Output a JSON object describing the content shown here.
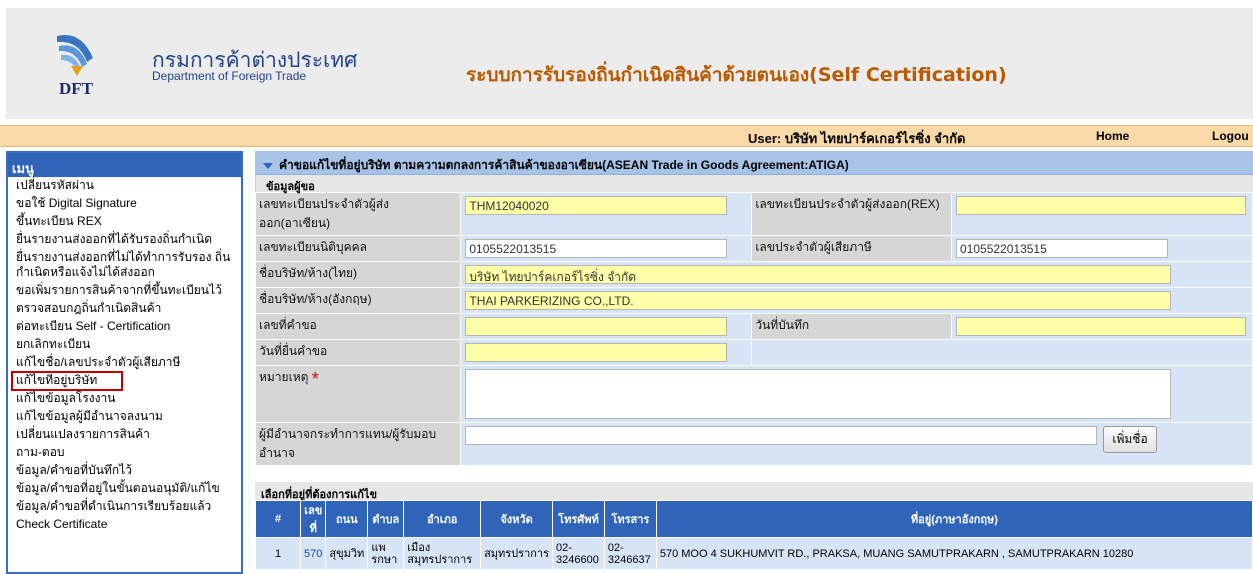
{
  "header": {
    "dept_th": "กรมการค้าต่างประเทศ",
    "dept_en": "Department of Foreign Trade",
    "logo_text": "DFT",
    "system_title": "ระบบการรับรองถิ่นกำเนิดสินค้าด้วยตนเอง(Self Certification)"
  },
  "userbar": {
    "user_label": "User: บริษัท ไทยปาร์คเกอร์ไรซิ่ง จำกัด",
    "home": "Home",
    "logout": "Logou"
  },
  "sidebar": {
    "title": "เมนู",
    "items": [
      "เปลี่ยนรหัสผ่าน",
      "ขอใช้ Digital Signature",
      "ขึ้นทะเบียน REX",
      "ยื่นรายงานส่งออกที่ได้รับรองถิ่นกำเนิด",
      "ยื่นรายงานส่งออกที่ไม่ได้ทำการรับรอง ถิ่นกำเนิดหรือแจ้งไม่ได้ส่งออก",
      "ขอเพิ่มรายการสินค้าจากที่ขึ้นทะเบียนไว้",
      "ตรวจสอบกฎถิ่นกำเนิดสินค้า",
      "ต่อทะเบียน Self - Certification",
      "ยกเลิกทะเบียน",
      "แก้ไขชื่อ/เลขประจำตัวผู้เสียภาษี",
      "แก้ไขที่อยู่บริษัท",
      "แก้ไขข้อมูลโรงงาน",
      "แก้ไขข้อมูลผู้มีอำนาจลงนาม",
      "เปลี่ยนแปลงรายการสินค้า",
      "ถาม-ตอบ",
      "ข้อมูล/คำขอที่บันทึกไว้",
      "ข้อมูล/คำขอที่อยู่ในขั้นตอนอนุมัติ/แก้ไข",
      "ข้อมูล/คำขอที่ดำเนินการเรียบร้อยแล้ว",
      "Check Certificate"
    ]
  },
  "form": {
    "title": "คำขอแก้ไขที่อยู่บริษัท ตามความตกลงการค้าสินค้าของอาเซียน(ASEAN Trade in Goods Agreement:ATIGA)",
    "section": "ข้อมูลผู้ขอ",
    "labels": {
      "exporter_id": "เลขทะเบียนประจำตัวผู้ส่งออก(อาเซียน)",
      "rex_id": "เลขทะเบียนประจำตัวผู้ส่งออก(REX)",
      "juristic_id": "เลขทะเบียนนิติบุคคล",
      "tax_id": "เลขประจำตัวผู้เสียภาษี",
      "company_th": "ชื่อบริษัท/ห้าง(ไทย)",
      "company_en": "ชื่อบริษัท/ห้าง(อังกฤษ)",
      "request_no": "เลขที่คำขอ",
      "record_date": "วันที่บันทึก",
      "submit_date": "วันที่ยื่นคำขอ",
      "remark": "หมายเหตุ",
      "remark_required": "*",
      "delegate": "ผู้มีอำนาจกระทำการแทน/ผู้รับมอบอำนาจ"
    },
    "values": {
      "exporter_id": "THM12040020",
      "rex_id": "",
      "juristic_id": "0105522013515",
      "tax_id": "0105522013515",
      "company_th": "บริษัท ไทยปาร์คเกอร์ไรซิ่ง จำกัด",
      "company_en": "THAI PARKERIZING CO.,LTD.",
      "request_no": "",
      "record_date": "",
      "submit_date": "",
      "remark": "",
      "delegate": ""
    },
    "add_button": "เพิ่มชื่อ"
  },
  "address_section": {
    "title": "เลือกที่อยู่ที่ต้องการแก้ไข",
    "columns": [
      "#",
      "เลขที่",
      "ถนน",
      "ตำบล",
      "อำเภอ",
      "จังหวัด",
      "โทรศัพท์",
      "โทรสาร",
      "ที่อยู่(ภาษาอังกฤษ)"
    ],
    "rows": [
      [
        "1",
        "570",
        "สุขุมวิท",
        "แพรกษา",
        "เมืองสมุทรปราการ",
        "สมุทรปราการ",
        "02-3246600",
        "02-3246637",
        "570 MOO 4 SUKHUMVIT RD., PRAKSA, MUANG SAMUTPRAKARN , SAMUTPRAKARN 10280"
      ]
    ]
  },
  "colors": {
    "title_orange": "#b85a00",
    "menu_blue": "#2f64b8",
    "userbar": "#f9d9a8",
    "highlight_red": "#c00000"
  }
}
